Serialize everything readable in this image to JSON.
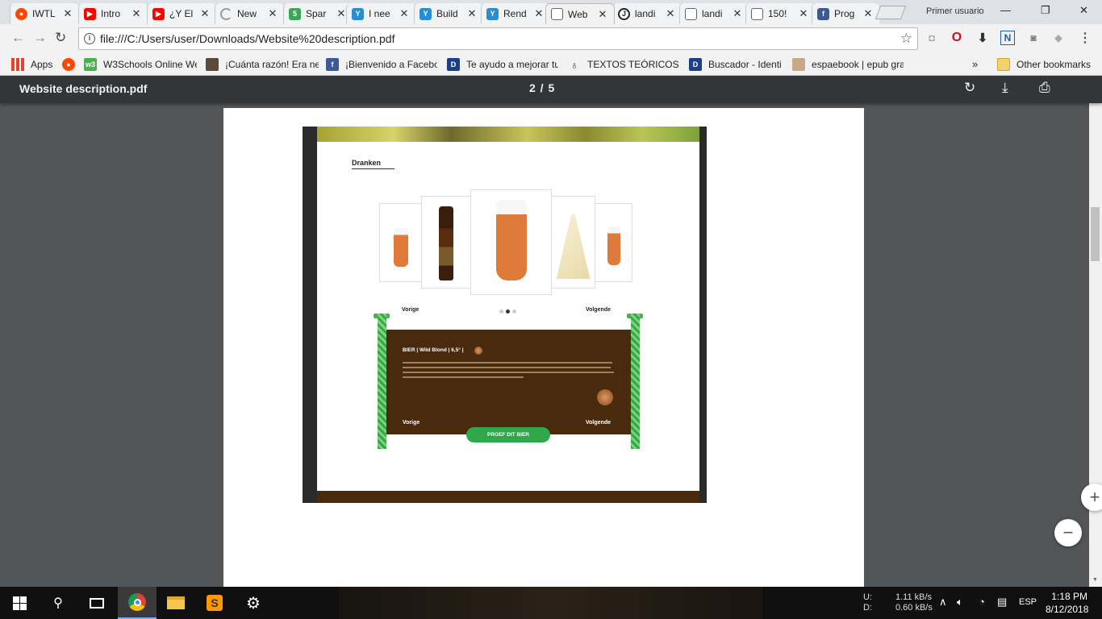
{
  "tabs": [
    {
      "title": "IWTL",
      "icon": "reddit-icon",
      "color": "#ff4500"
    },
    {
      "title": "Intro",
      "icon": "youtube-icon",
      "color": "#ff0000"
    },
    {
      "title": "¿Y El",
      "icon": "youtube-icon",
      "color": "#ff0000"
    },
    {
      "title": "New",
      "icon": "loading-icon",
      "color": "#888888"
    },
    {
      "title": "Spar",
      "icon": "five-icon",
      "color": "#3aa757"
    },
    {
      "title": "I nee",
      "icon": "y-icon",
      "color": "#2a8dd4"
    },
    {
      "title": "Build",
      "icon": "y-icon",
      "color": "#2a8dd4"
    },
    {
      "title": "Rend",
      "icon": "y-icon",
      "color": "#2a8dd4"
    },
    {
      "title": "Web",
      "icon": "document-icon",
      "color": "#555555"
    },
    {
      "title": "landi",
      "icon": "circle-j-icon",
      "color": "#222222"
    },
    {
      "title": "landi",
      "icon": "document-icon",
      "color": "#555555"
    },
    {
      "title": "150!",
      "icon": "document-icon",
      "color": "#555555"
    },
    {
      "title": "Prog",
      "icon": "facebook-icon",
      "color": "#3b5998"
    }
  ],
  "profile_name": "Primer usuario",
  "url": "file:///C:/Users/user/Downloads/Website%20description.pdf",
  "bookmarks": [
    {
      "label": "Apps",
      "icon": "apps-grid-icon"
    },
    {
      "label": "",
      "icon": "reddit-icon"
    },
    {
      "label": "W3Schools Online We",
      "icon": "w3schools-icon"
    },
    {
      "label": "¡Cuánta razón! Era ne",
      "icon": "image-icon"
    },
    {
      "label": "¡Bienvenido a Facebo",
      "icon": "facebook-icon"
    },
    {
      "label": "Te ayudo a mejorar tu",
      "icon": "d-square-icon"
    },
    {
      "label": "TEXTOS TEÓRICOS en",
      "icon": "lightbulb-icon"
    },
    {
      "label": "Buscador - Identi",
      "icon": "d-square-icon"
    },
    {
      "label": "espaebook | epub gra",
      "icon": "book-icon"
    }
  ],
  "bookmarks_overflow": "»",
  "other_bookmarks": "Other bookmarks",
  "pdf": {
    "title": "Website description.pdf",
    "page_counter": "2  /  5"
  },
  "site": {
    "heading": "Dranken",
    "prev": "Vorige",
    "next": "Volgende",
    "bier_title": "BIER | Wild Blond | 6,5° |",
    "cta": "PROEF DIT BIER"
  },
  "taskbar": {
    "net_labels": "U:\nD:",
    "net_values": "1.11 kB/s\n0.60 kB/s",
    "language": "ESP",
    "time": "1:18 PM",
    "date": "8/12/2018"
  }
}
